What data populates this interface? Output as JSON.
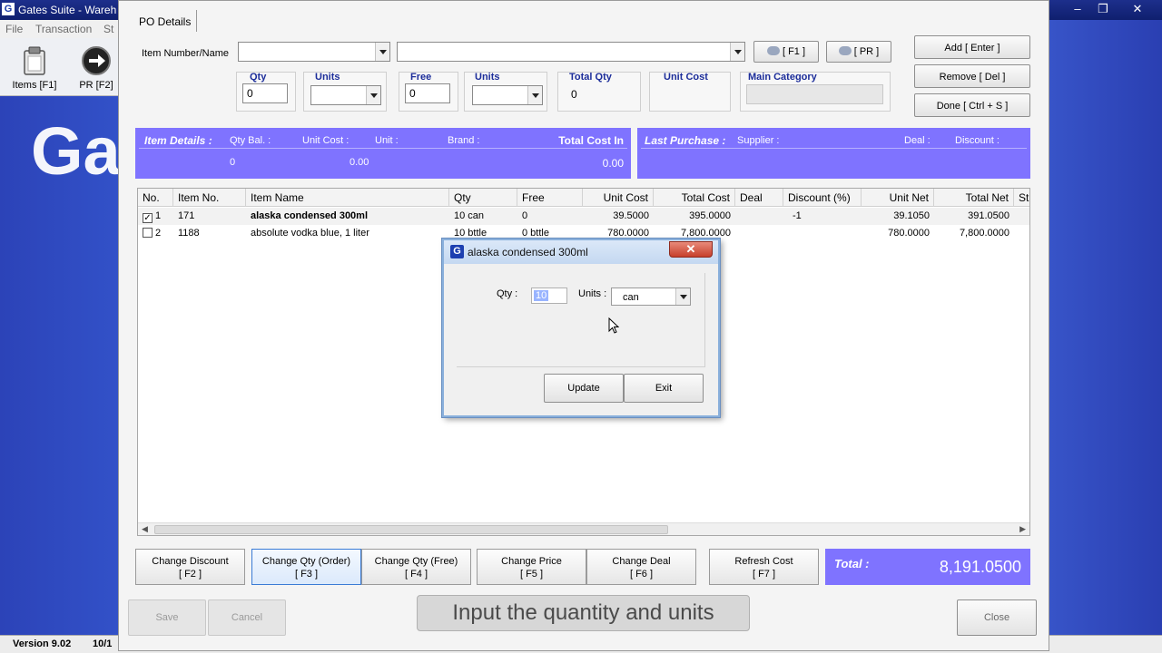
{
  "app": {
    "title": "Gates Suite - Wareh",
    "logo_letter": "G",
    "menu": [
      "File",
      "Transaction",
      "St"
    ],
    "toolbar": [
      {
        "label": "Items [F1]",
        "icon": "clipboard-icon"
      },
      {
        "label": "PR [F2]",
        "icon": "arrow-right-icon"
      }
    ],
    "brand_text": "Ga",
    "version": "Version 9.02",
    "status_date": "10/1"
  },
  "po": {
    "tab": "PO Details",
    "item_number_label": "Item Number/Name",
    "item_number_value": "",
    "item_desc_value": "",
    "f1_button": "[ F1 ]",
    "pr_button": "[ PR ]",
    "add_button": "Add [ Enter ]",
    "remove_button": "Remove [ Del ]",
    "done_button": "Done [ Ctrl + S ]",
    "fields": {
      "qty_label": "Qty",
      "qty_value": "0",
      "units_label": "Units",
      "free_label": "Free",
      "free_value": "0",
      "units2_label": "Units",
      "total_qty_label": "Total Qty",
      "total_qty_value": "0",
      "unit_cost_label": "Unit Cost",
      "main_category_label": "Main Category"
    },
    "item_details": {
      "header": "Item Details :",
      "qty_bal_label": "Qty Bal. :",
      "unit_cost_label": "Unit Cost :",
      "unit_label": "Unit :",
      "brand_label": "Brand :",
      "total_cost_label": "Total Cost In",
      "qty_bal_value": "0",
      "unit_cost_value": "0.00",
      "total_cost_value": "0.00"
    },
    "last_purchase": {
      "header": "Last Purchase :",
      "supplier_label": "Supplier :",
      "deal_label": "Deal :",
      "discount_label": "Discount :"
    },
    "grid": {
      "columns": [
        "No.",
        "Item No.",
        "Item Name",
        "Qty",
        "Free",
        "Unit Cost",
        "Total Cost",
        "Deal",
        "Discount (%)",
        "Unit Net",
        "Total Net",
        "St"
      ],
      "rows": [
        {
          "checked": true,
          "no": "1",
          "item_no": "171",
          "name": "alaska condensed  300ml",
          "qty": "10 can",
          "free": "0",
          "unit_cost": "39.5000",
          "total_cost": "395.0000",
          "deal": "",
          "discount": "-1",
          "unit_net": "39.1050",
          "total_net": "391.0500"
        },
        {
          "checked": false,
          "no": "2",
          "item_no": "1188",
          "name": "absolute vodka blue, 1 liter",
          "qty": "10 bttle",
          "free": "0 bttle",
          "unit_cost": "780.0000",
          "total_cost": "7,800.0000",
          "deal": "",
          "discount": "",
          "unit_net": "780.0000",
          "total_net": "7,800.0000"
        }
      ]
    },
    "function_buttons": [
      {
        "label": "Change Discount\n[ F2 ]"
      },
      {
        "label": "Change Qty (Order)\n[ F3 ]"
      },
      {
        "label": "Change Qty (Free)\n[ F4 ]"
      },
      {
        "label": "Change Price\n[ F5 ]"
      },
      {
        "label": "Change Deal\n[ F6 ]"
      },
      {
        "label": "Refresh Cost\n[ F7 ]"
      }
    ],
    "total_label": "Total :",
    "total_value": "8,191.0500",
    "save_button": "Save",
    "cancel_button": "Cancel",
    "close_button": "Close"
  },
  "dialog": {
    "title": "alaska condensed  300ml",
    "close_glyph": "✕",
    "qty_label": "Qty :",
    "qty_value": "10",
    "units_label": "Units :",
    "units_value": "can",
    "update_button": "Update",
    "exit_button": "Exit"
  },
  "caption": "Input the quantity and units",
  "colors": {
    "banner": "#7f73ff",
    "desktop": "#2b3fb4",
    "label_blue": "#1c2d9a"
  }
}
